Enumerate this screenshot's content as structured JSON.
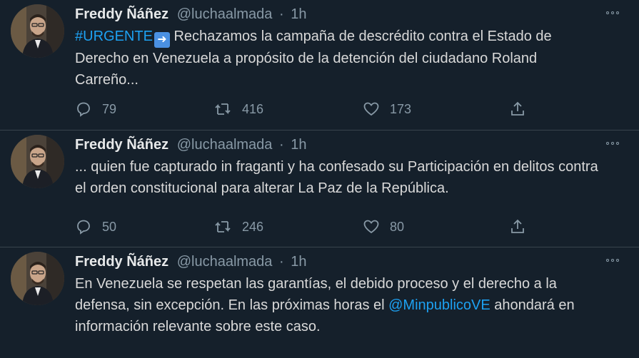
{
  "tweets": [
    {
      "name": "Freddy Ñáñez",
      "handle": "@luchaalmada",
      "dot": "·",
      "time": "1h",
      "hashtag": "#URGENTE",
      "emoji": "➡️",
      "text": " Rechazamos la campaña de descrédito contra el Estado de Derecho en Venezuela a propósito de la detención del ciudadano Roland Carreño...",
      "replies": "79",
      "retweets": "416",
      "likes": "173"
    },
    {
      "name": "Freddy Ñáñez",
      "handle": "@luchaalmada",
      "dot": "·",
      "time": "1h",
      "text": "... quien fue capturado in fraganti y ha confesado su Participación en delitos contra el orden constitucional para alterar La Paz de la República.",
      "replies": "50",
      "retweets": "246",
      "likes": "80"
    },
    {
      "name": "Freddy Ñáñez",
      "handle": "@luchaalmada",
      "dot": "·",
      "time": "1h",
      "text_before": "En Venezuela se respetan las garantías, el debido proceso y el derecho a la defensa, sin excepción.  En las próximas horas el ",
      "mention": "@MinpublicoVE",
      "text_after": " ahondará en información relevante sobre este caso."
    }
  ],
  "colors": {
    "background": "#15202b",
    "link": "#1da1f2",
    "muted": "#8899a6",
    "divider": "#38444d"
  }
}
